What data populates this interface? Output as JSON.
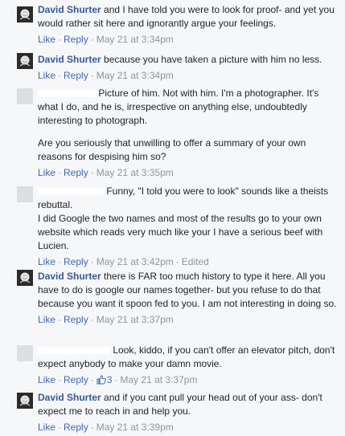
{
  "comments": [
    {
      "author": "David Shurter",
      "text": "and I have told you were to look for proof- and yet you would rather sit here and ignorantly argue your feelings.",
      "like": "Like",
      "reply": "Reply",
      "timestamp": "May 21 at 3:34pm"
    },
    {
      "author": "David Shurter",
      "text": "because you have taken a picture with him no less.",
      "like": "Like",
      "reply": "Reply",
      "timestamp": "May 21 at 3:34pm"
    },
    {
      "paragraph1": "Picture of him. Not with him. I'm a photographer. It's what I do, and he is, irrespective on anything else, undoubtedly interesting to photograph.",
      "paragraph2": "Are you seriously that unwilling to offer a summary of your own reasons for despising him so?",
      "like": "Like",
      "reply": "Reply",
      "timestamp": "May 21 at 3:35pm"
    },
    {
      "paragraph1": "Funny, \"I told you were to look\" sounds like a theists rebuttal.",
      "paragraph2": "I did Google the two names and most of the results go to your own website which reads very much like your I have a serious beef with Lucien.",
      "like": "Like",
      "reply": "Reply",
      "timestamp": "May 21 at 3:42pm",
      "edited": "Edited"
    },
    {
      "author": "David Shurter",
      "text": "there is FAR too much history to type it here. All you have to do is google our names together- but you refuse to do that because you want it spoon fed to you. I am not interesting in doing so.",
      "like": "Like",
      "reply": "Reply",
      "timestamp": "May 21 at 3:37pm"
    },
    {
      "text": "Look, kiddo, if you can't offer an elevator pitch, don't expect anybody to make your damn movie.",
      "like": "Like",
      "reply": "Reply",
      "like_count": "3",
      "timestamp": "May 21 at 3:37pm"
    },
    {
      "author": "David Shurter",
      "text": "and if you cant pull your head out of your ass- don't expect me to reach in and help you.",
      "like": "Like",
      "reply": "Reply",
      "timestamp": "May 21 at 3:39pm"
    }
  ],
  "colors": {
    "background": "#f6f7f9",
    "link": "#4267b2",
    "name": "#365899",
    "meta": "#90949c",
    "text": "#1d2129"
  },
  "icons": {
    "avatar": "rose-avatar-icon",
    "like_count": "thumbs-up-icon"
  }
}
